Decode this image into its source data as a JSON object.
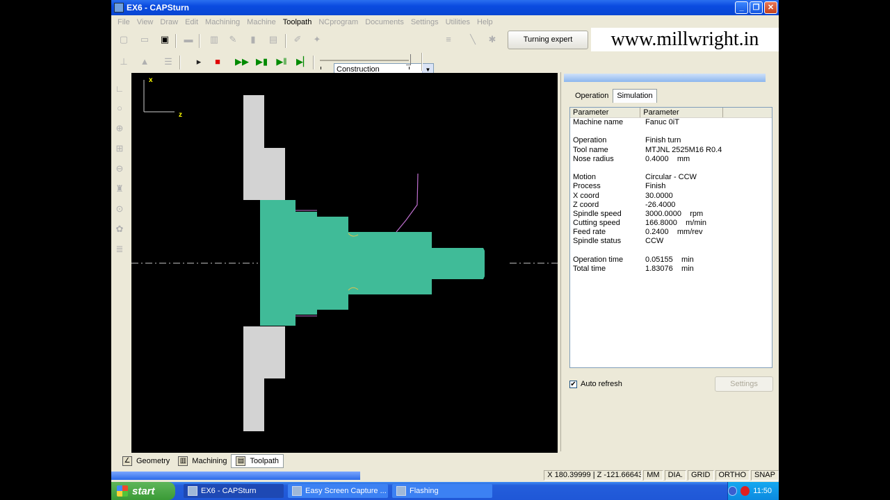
{
  "window": {
    "title": "EX6 - CAPSturn"
  },
  "menu": [
    "File",
    "View",
    "Draw",
    "Edit",
    "Machining",
    "Machine",
    "Toolpath",
    "NCprogram",
    "Documents",
    "Settings",
    "Utilities",
    "Help"
  ],
  "toolbar": {
    "combo_value": "Construction",
    "expert_button": "Turning expert",
    "watermark": "www.millwright.in"
  },
  "canvas": {
    "axis_x": "x",
    "axis_z": "z"
  },
  "panel": {
    "tabs": [
      "Operation",
      "Simulation"
    ],
    "columns": [
      "Parameter",
      "Parameter"
    ],
    "rows": [
      [
        "Machine name",
        "Fanuc 0iT"
      ],
      [
        "",
        ""
      ],
      [
        "Operation",
        "Finish turn"
      ],
      [
        "Tool name",
        "MTJNL 2525M16 R0.4"
      ],
      [
        "Nose radius",
        "0.4000    mm"
      ],
      [
        "",
        ""
      ],
      [
        "Motion",
        "Circular - CCW"
      ],
      [
        "Process",
        "Finish"
      ],
      [
        "X coord",
        "30.0000"
      ],
      [
        "Z coord",
        "-26.4000"
      ],
      [
        "Spindle speed",
        "3000.0000    rpm"
      ],
      [
        "Cutting speed",
        "166.8000    m/min"
      ],
      [
        "Feed rate",
        "0.2400    mm/rev"
      ],
      [
        "Spindle status",
        "CCW"
      ],
      [
        "",
        ""
      ],
      [
        "Operation time",
        "0.05155    min"
      ],
      [
        "Total time",
        "1.83076    min"
      ]
    ],
    "auto_refresh_label": "Auto refresh",
    "settings_button": "Settings"
  },
  "bottom_tabs": [
    "Geometry",
    "Machining",
    "Toolpath"
  ],
  "status": {
    "coords": "X 180.39999 | Z -121.66643",
    "unit": "MM",
    "dia": "DIA.",
    "grid": "GRID",
    "ortho": "ORTHO",
    "snap": "SNAP"
  },
  "taskbar": {
    "start": "start",
    "tasks": [
      "EX6 - CAPSturn",
      "Easy Screen Capture ...",
      "Flashing"
    ],
    "clock": "11:50"
  }
}
